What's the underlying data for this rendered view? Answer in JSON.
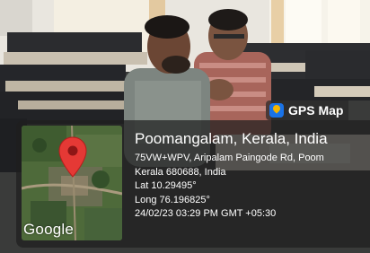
{
  "overlay": {
    "app_name": "GPS Map",
    "map_attribution": "Google",
    "location_title": "Poomangalam, Kerala, India",
    "address_line_1": "75VW+WPV, Aripalam Paingode Rd, Poom",
    "address_line_2": "Kerala 680688, India",
    "latitude": "Lat 10.29495°",
    "longitude": "Long 76.196825°",
    "timestamp": "24/02/23 03:29 PM GMT +05:30"
  },
  "icons": {
    "app": "gps-map-camera-icon",
    "pin": "map-pin-icon"
  },
  "colors": {
    "pin": "#e53935",
    "overlay": "#1e1e1e",
    "text": "#ffffff"
  }
}
